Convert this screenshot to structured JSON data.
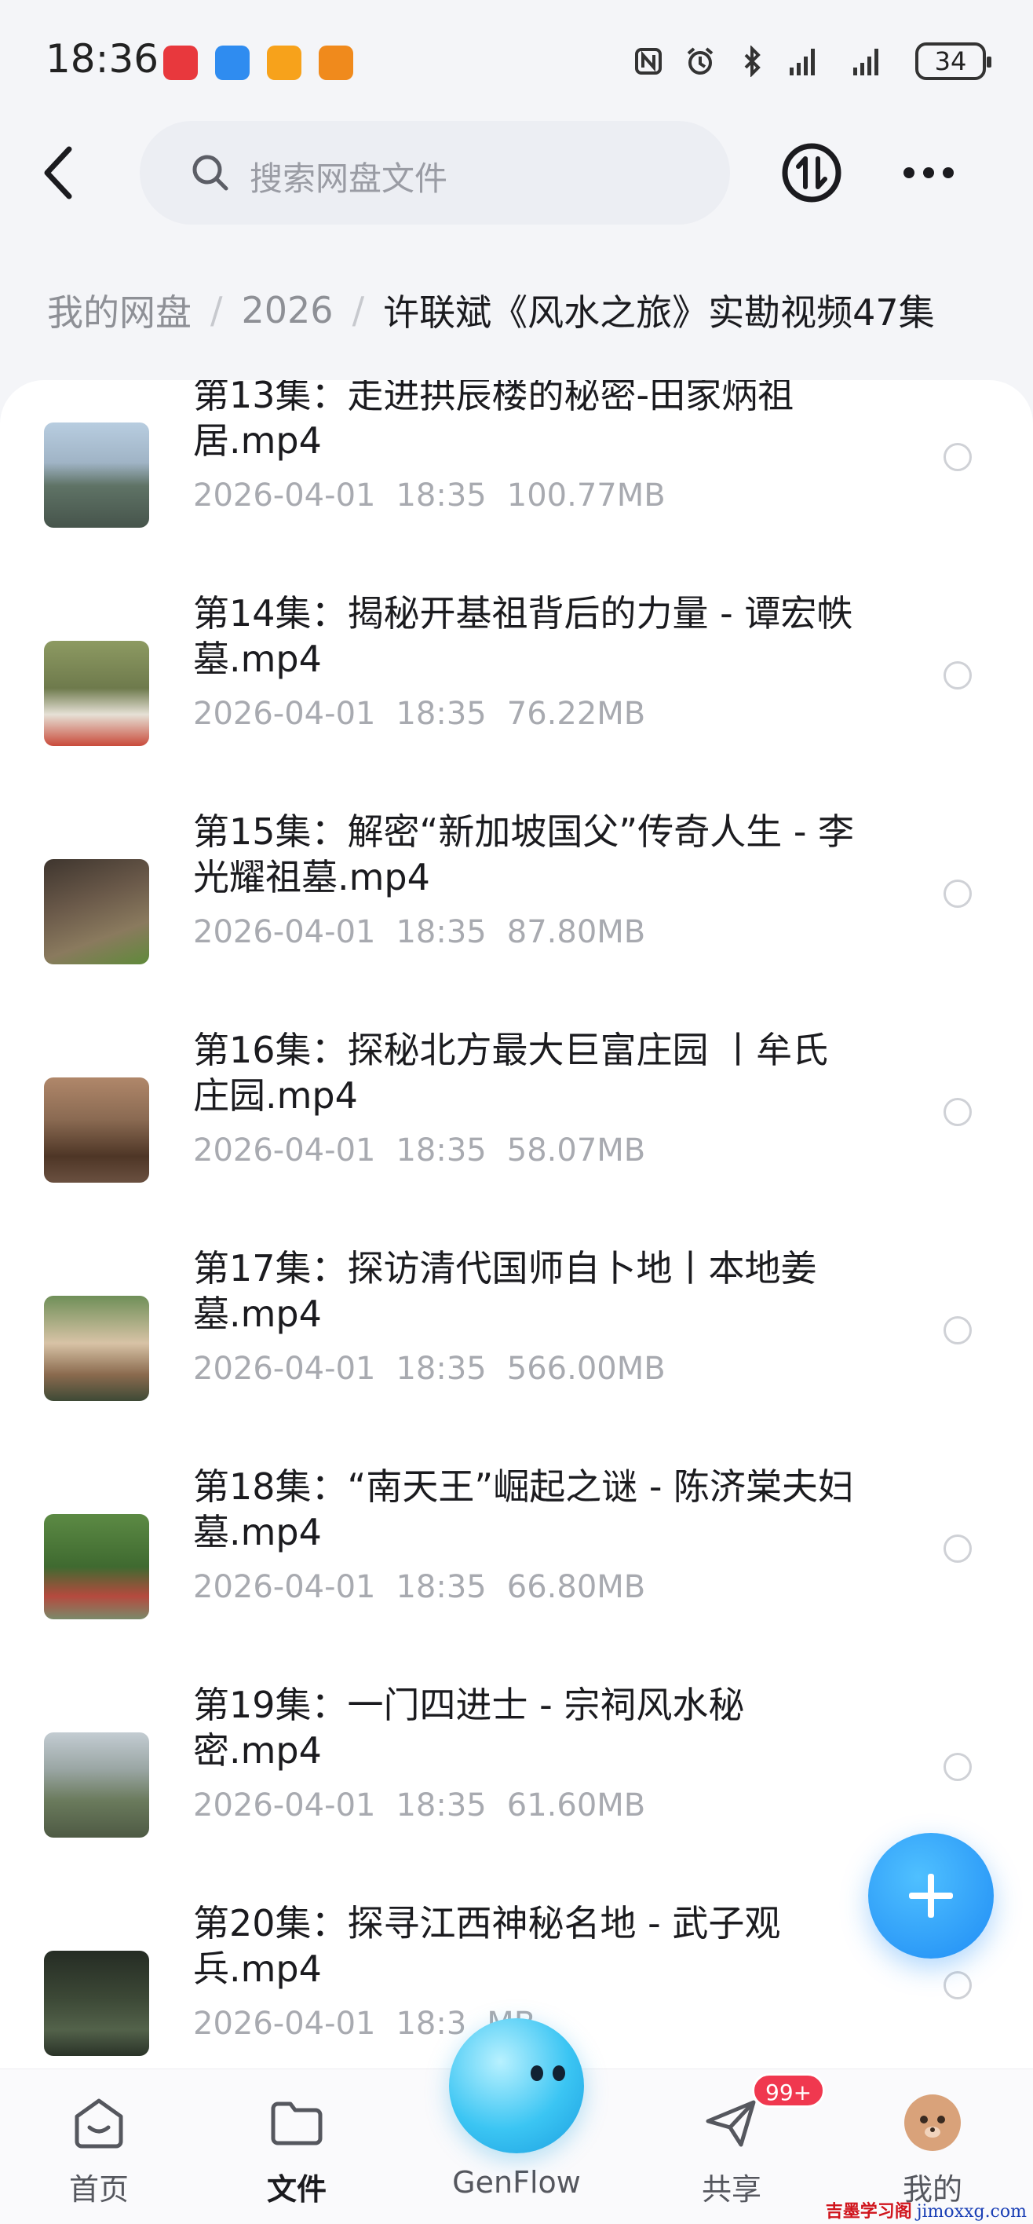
{
  "status_bar": {
    "time": "18:36",
    "battery": "34",
    "app_icon_colors": [
      "#e8383d",
      "#2f8cf0",
      "#f7a21b",
      "#f08a1c"
    ]
  },
  "header": {
    "search_placeholder": "搜索网盘文件",
    "icons": {
      "back": "back-arrow-icon",
      "transfer": "transfer-icon",
      "more": "more-icon"
    }
  },
  "breadcrumb": {
    "items": [
      "我的网盘",
      "2026"
    ],
    "separator": "/",
    "current": "许联斌《风水之旅》实勘视频47集"
  },
  "files": [
    {
      "name": "第13集：走进拱辰楼的秘密-田家炳祖居.mp4",
      "date": "2026-04-01",
      "time": "18:35",
      "size": "100.77MB",
      "thumb_colors": [
        "#a9c3dc",
        "#4f5f58"
      ]
    },
    {
      "name": "第14集：揭秘开基祖背后的力量 - 谭宏帙墓.mp4",
      "date": "2026-04-01",
      "time": "18:35",
      "size": "76.22MB",
      "thumb_colors": [
        "#7e8a5a",
        "#d9d4c8"
      ]
    },
    {
      "name": "第15集：解密“新加坡国父”传奇人生 - 李光耀祖墓.mp4",
      "date": "2026-04-01",
      "time": "18:35",
      "size": "87.80MB",
      "thumb_colors": [
        "#5a4a3e",
        "#8a9a6a"
      ]
    },
    {
      "name": "第16集：探秘北方最大巨富庄园 丨牟氏庄园.mp4",
      "date": "2026-04-01",
      "time": "18:35",
      "size": "58.07MB",
      "thumb_colors": [
        "#9a7a60",
        "#5e4230"
      ]
    },
    {
      "name": "第17集：探访清代国师自卜地丨本地姜墓.mp4",
      "date": "2026-04-01",
      "time": "18:35",
      "size": "566.00MB",
      "thumb_colors": [
        "#6f8a56",
        "#c7b49a"
      ]
    },
    {
      "name": "第18集：“南天王”崛起之谜 - 陈济棠夫妇墓.mp4",
      "date": "2026-04-01",
      "time": "18:35",
      "size": "66.80MB",
      "thumb_colors": [
        "#4f7a3c",
        "#b8463a"
      ]
    },
    {
      "name": "第19集：一门四进士 - 宗祠风水秘密.mp4",
      "date": "2026-04-01",
      "time": "18:35",
      "size": "61.60MB",
      "thumb_colors": [
        "#b7c2c8",
        "#5f6f58"
      ]
    },
    {
      "name": "第20集：探寻江西神秘名地 - 武子观兵.mp4",
      "date": "2026-04-01",
      "time": "18:3",
      "size": "MB",
      "thumb_colors": [
        "#2a3328",
        "#53624a"
      ]
    }
  ],
  "fab": {
    "icon": "plus-icon"
  },
  "bottom_nav": [
    {
      "label": "首页",
      "icon": "home-icon",
      "active": false
    },
    {
      "label": "文件",
      "icon": "folder-icon",
      "active": true
    },
    {
      "label": "GenFlow",
      "icon": "genflow-icon",
      "active": false
    },
    {
      "label": "共享",
      "icon": "share-icon",
      "active": false
    },
    {
      "label": "我的",
      "icon": "avatar-icon",
      "active": false
    }
  ],
  "share_badge": "99+",
  "watermark": {
    "cn": "吉墨学习阁",
    "en": "jimoxxg.com"
  }
}
